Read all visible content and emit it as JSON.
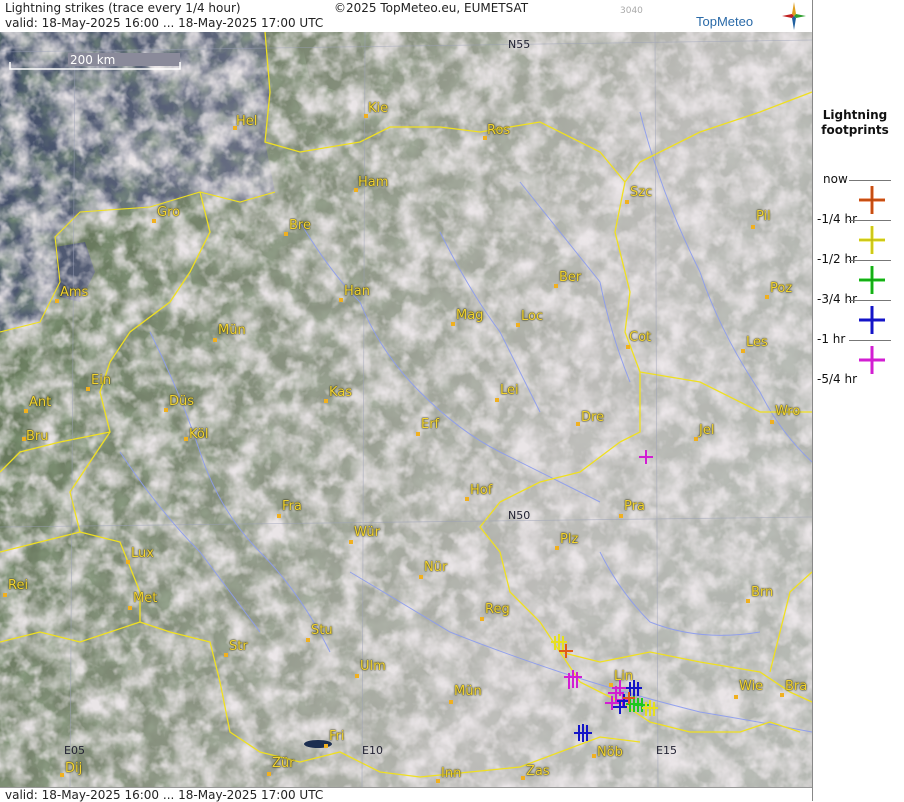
{
  "header": {
    "title": "Lightning strikes (trace every 1/4 hour)",
    "copyright": "©2025 TopMeteo.eu, EUMETSAT",
    "code": "3040",
    "valid": "valid:  18-May-2025 16:00 ... 18-May-2025 17:00 UTC",
    "logo_text": "TopMeteo"
  },
  "footer": {
    "valid": "valid:  18-May-2025 16:00 ... 18-May-2025 17:00 UTC"
  },
  "map": {
    "scale_label": "200 km",
    "grid_labels": [
      "N55",
      "N50",
      "E05",
      "E10",
      "E15"
    ],
    "cities": [
      "Hel",
      "Kie",
      "Ros",
      "Ham",
      "Szc",
      "Gro",
      "Bre",
      "Pil",
      "Ber",
      "Ams",
      "Han",
      "Poz",
      "Mag",
      "Loc",
      "Mün",
      "Cot",
      "Les",
      "Ein",
      "Lei",
      "Kas",
      "Ant",
      "Düs",
      "Wro",
      "Dre",
      "Bru",
      "Erf",
      "Köl",
      "Jel",
      "Hof",
      "Fra",
      "Pra",
      "Wür",
      "Plz",
      "Lux",
      "Nür",
      "Rei",
      "Brn",
      "Met",
      "Reg",
      "Stu",
      "Str",
      "Ulm",
      "Lin",
      "Wie",
      "Bra",
      "Mün",
      "Fri",
      "Nöb",
      "Dij",
      "Zür",
      "Inn",
      "Zas"
    ],
    "colors": {
      "border": "#f0e020",
      "river": "#8c9cf0",
      "city": "#f3d431",
      "sea": "#1c2e50"
    }
  },
  "legend": {
    "title": "Lightning footprints",
    "items": [
      {
        "label": "now",
        "color": "#e05a18"
      },
      {
        "label": "-1/4 hr",
        "color": "#e6e020"
      },
      {
        "label": "-1/2 hr",
        "color": "#1ec81e"
      },
      {
        "label": "-3/4 hr",
        "color": "#1414c8"
      },
      {
        "label": "-1 hr",
        "color": "#d21ed2"
      },
      {
        "label": "-5/4 hr"
      }
    ]
  },
  "strikes": [
    {
      "age": "now",
      "color": "#e05a18",
      "count": 2
    },
    {
      "age": "-1/4 hr",
      "color": "#e6e020",
      "count": 4
    },
    {
      "age": "-1/2 hr",
      "color": "#1ec81e",
      "count": 4
    },
    {
      "age": "-3/4 hr",
      "color": "#1414c8",
      "count": 5
    },
    {
      "age": "-1 hr",
      "color": "#d21ed2",
      "count": 6
    }
  ]
}
